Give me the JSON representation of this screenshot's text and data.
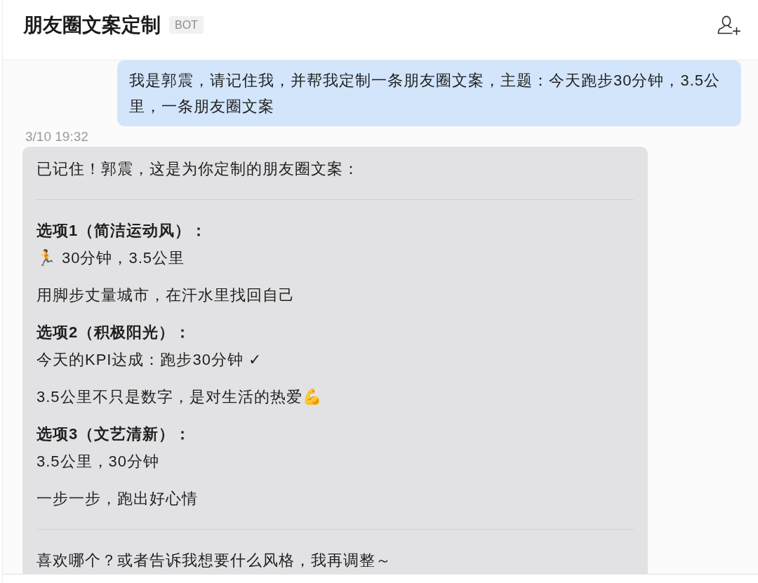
{
  "header": {
    "title": "朋友圈文案定制",
    "badge": "BOT"
  },
  "messages": [
    {
      "kind": "user",
      "text": "我是郭震，请记住我，并帮我定制一条朋友圈文案，主题：今天跑步30分钟，3.5公里，一条朋友圈文案"
    },
    {
      "kind": "bot",
      "timestamp": "3/10 19:32",
      "blocks": [
        {
          "kind": "paragraph",
          "lines": [
            {
              "kind": "text",
              "text": "已记住！郭震，这是为你定制的朋友圈文案："
            }
          ]
        },
        {
          "kind": "divider"
        },
        {
          "kind": "paragraph",
          "lines": [
            {
              "kind": "heading",
              "text": "选项1（简洁运动风）："
            },
            {
              "kind": "text",
              "lead": "🏃",
              "text": "30分钟，3.5公里"
            }
          ]
        },
        {
          "kind": "paragraph",
          "lines": [
            {
              "kind": "text",
              "text": "用脚步丈量城市，在汗水里找回自己"
            }
          ]
        },
        {
          "kind": "paragraph",
          "lines": [
            {
              "kind": "heading",
              "text": "选项2（积极阳光）："
            },
            {
              "kind": "text",
              "text": "今天的KPI达成：跑步30分钟 ✓"
            }
          ]
        },
        {
          "kind": "paragraph",
          "lines": [
            {
              "kind": "text",
              "text": "3.5公里不只是数字，是对生活的热爱",
              "trail": "💪"
            }
          ]
        },
        {
          "kind": "paragraph",
          "lines": [
            {
              "kind": "heading",
              "text": "选项3（文艺清新）："
            },
            {
              "kind": "text",
              "text": "3.5公里，30分钟"
            }
          ]
        },
        {
          "kind": "paragraph",
          "lines": [
            {
              "kind": "text",
              "text": "一步一步，跑出好心情"
            }
          ]
        },
        {
          "kind": "divider"
        },
        {
          "kind": "paragraph",
          "lines": [
            {
              "kind": "text",
              "text": "喜欢哪个？或者告诉我想要什么风格，我再调整～"
            }
          ]
        }
      ]
    }
  ]
}
